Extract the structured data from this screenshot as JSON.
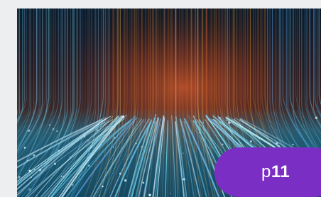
{
  "hero": {
    "image_description_icon": "data-light-streams-image"
  },
  "badge": {
    "prefix": "p",
    "number": "11",
    "color": "#7b2ec3"
  }
}
